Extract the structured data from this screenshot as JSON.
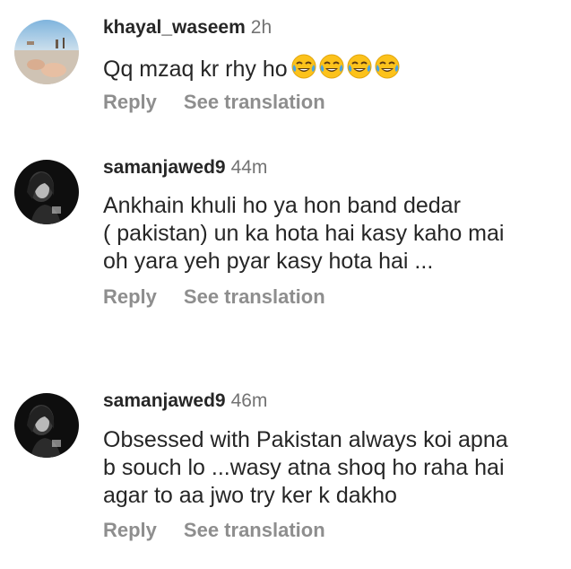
{
  "comments": [
    {
      "username": "khayal_waseem",
      "time": "2h",
      "text": "Qq mzaq kr rhy ho",
      "emoji": [
        "face-with-tears-of-joy-icon",
        "face-with-tears-of-joy-icon",
        "face-with-tears-of-joy-icon",
        "face-with-tears-of-joy-icon"
      ],
      "reply_label": "Reply",
      "translate_label": "See translation"
    },
    {
      "username": "samanjawed9",
      "time": "44m",
      "text": "Ankhain khuli ho ya hon band dedar\n( pakistan) un ka hota hai kasy kaho mai\noh yara yeh pyar kasy hota hai ...",
      "reply_label": "Reply",
      "translate_label": "See translation"
    },
    {
      "username": "samanjawed9",
      "time": "46m",
      "text": "Obsessed with Pakistan always koi apna\nb souch lo ...wasy atna shoq ho raha hai\nagar to aa jwo try ker k dakho",
      "reply_label": "Reply",
      "translate_label": "See translation"
    }
  ],
  "colors": {
    "username": "#262626",
    "timestamp": "#737373",
    "actions": "#8e8e8e",
    "body_text": "#262626"
  }
}
